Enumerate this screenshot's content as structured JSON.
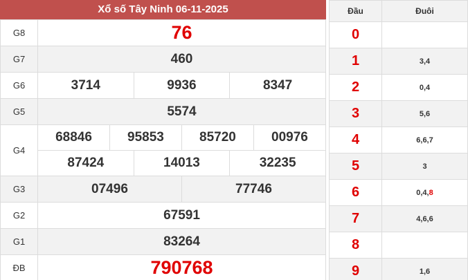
{
  "title": "Xổ số Tây Ninh 06-11-2025",
  "prizes": {
    "g8": {
      "label": "G8",
      "numbers": [
        "76"
      ]
    },
    "g7": {
      "label": "G7",
      "numbers": [
        "460"
      ]
    },
    "g6": {
      "label": "G6",
      "numbers": [
        "3714",
        "9936",
        "8347"
      ]
    },
    "g5": {
      "label": "G5",
      "numbers": [
        "5574"
      ]
    },
    "g4": {
      "label": "G4",
      "numbers": [
        "68846",
        "95853",
        "85720",
        "00976",
        "87424",
        "14013",
        "32235"
      ]
    },
    "g3": {
      "label": "G3",
      "numbers": [
        "07496",
        "77746"
      ]
    },
    "g2": {
      "label": "G2",
      "numbers": [
        "67591"
      ]
    },
    "g1": {
      "label": "G1",
      "numbers": [
        "83264"
      ]
    },
    "db": {
      "label": "ĐB",
      "numbers": [
        "790768"
      ]
    }
  },
  "loto": {
    "head_label": "Đầu",
    "tail_label": "Đuôi",
    "rows": [
      {
        "head": "0",
        "tail": ""
      },
      {
        "head": "1",
        "tail": "3,4"
      },
      {
        "head": "2",
        "tail": "0,4"
      },
      {
        "head": "3",
        "tail": "5,6"
      },
      {
        "head": "4",
        "tail": "6,6,7"
      },
      {
        "head": "5",
        "tail": "3"
      },
      {
        "head": "6",
        "tail": "0,4,",
        "tail_highlight": "8"
      },
      {
        "head": "7",
        "tail": "4,6,6"
      },
      {
        "head": "8",
        "tail": ""
      },
      {
        "head": "9",
        "tail": "1,6"
      }
    ]
  },
  "colors": {
    "header_bg": "#c0504d",
    "highlight": "#e00000",
    "shade": "#f2f2f2"
  }
}
